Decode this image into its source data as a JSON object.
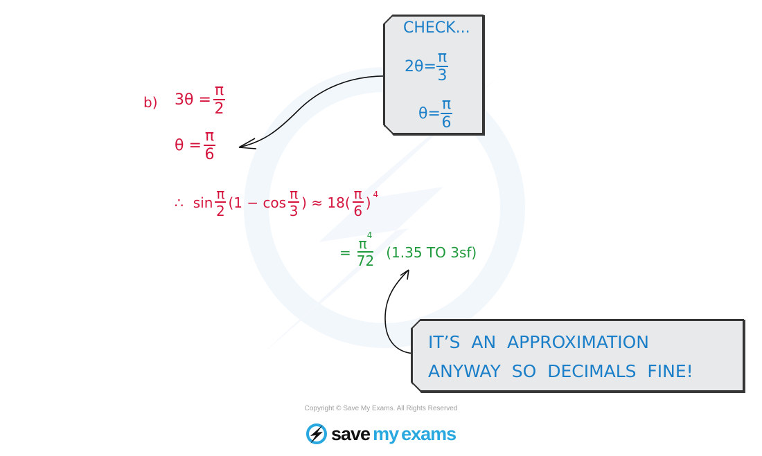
{
  "part_b": {
    "label": "b)",
    "line1": {
      "lhs": "3θ =",
      "num": "π",
      "den": "2"
    },
    "line2": {
      "lhs": "θ =",
      "num": "π",
      "den": "6"
    },
    "line3": {
      "therefore": "∴",
      "sin": "sin",
      "frac1": {
        "num": "π",
        "den": "2"
      },
      "mid": "(1 − cos",
      "frac2": {
        "num": "π",
        "den": "3"
      },
      "approx": ") ≈ 18(",
      "frac3": {
        "num": "π",
        "den": "6"
      },
      "close": ")",
      "power": "4"
    },
    "line4": {
      "eq": "=",
      "num": "π",
      "num_power": "4",
      "den": "72",
      "note": "(1.35 TO 3sf)"
    }
  },
  "check_note": {
    "title": "CHECK...",
    "line1": {
      "lhs": "2θ=",
      "num": "π",
      "den": "3"
    },
    "line2": {
      "lhs": "θ=",
      "num": "π",
      "den": "6"
    }
  },
  "approx_note": {
    "line1": "IT’S  AN  APPROXIMATION",
    "line2": "ANYWAY  SO  DECIMALS  FINE!"
  },
  "footer": {
    "copyright": "Copyright © Save My Exams. All Rights Reserved",
    "logo_word1": "save",
    "logo_word2": "my",
    "logo_word3": "exams"
  },
  "colors": {
    "working": "#d4143c",
    "note_text": "#1a7fc8",
    "answer": "#1e9a3c",
    "brand": "#29a8e0"
  }
}
